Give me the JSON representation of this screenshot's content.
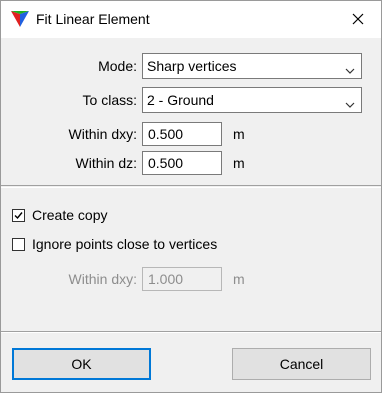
{
  "window": {
    "title": "Fit Linear Element",
    "app_icon": "terrasolid-triangle-icon",
    "close_icon": "close-icon"
  },
  "form": {
    "mode_label": "Mode:",
    "mode_value": "Sharp vertices",
    "class_label": "To class:",
    "class_value": "2 - Ground",
    "dxy_label": "Within dxy:",
    "dxy_value": "0.500",
    "dxy_unit": "m",
    "dz_label": "Within dz:",
    "dz_value": "0.500",
    "dz_unit": "m"
  },
  "options": {
    "create_copy_label": "Create copy",
    "create_copy_checked": true,
    "ignore_points_label": "Ignore points close to vertices",
    "ignore_points_checked": false,
    "ignore_dxy_label": "Within dxy:",
    "ignore_dxy_value": "1.000",
    "ignore_dxy_unit": "m"
  },
  "buttons": {
    "ok_label": "OK",
    "cancel_label": "Cancel"
  },
  "colors": {
    "accent": "#0078d7",
    "disabled_text": "#8d8d8d"
  }
}
